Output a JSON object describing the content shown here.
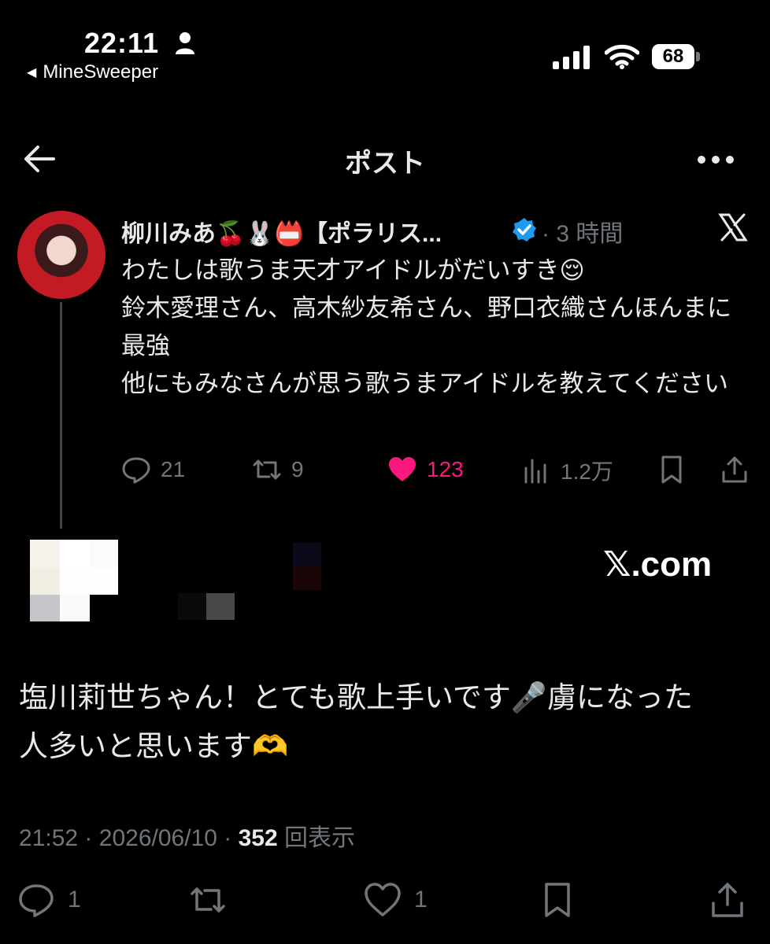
{
  "status_bar": {
    "time": "22:11",
    "back_app": "MineSweeper",
    "battery": "68"
  },
  "header": {
    "title": "ポスト"
  },
  "quoted_post": {
    "author_name": "柳川みあ🍒🐰📛【ポラリス...",
    "dot_time": "· 3 時間",
    "text": "わたしは歌うま天才アイドルがだいすき😌\n鈴木愛理さん、高木紗友希さん、野口衣織さんほんまに最強\n他にもみなさんが思う歌うまアイドルを教えてください",
    "replies": "21",
    "reposts": "9",
    "likes": "123",
    "views": "1.2万"
  },
  "embed": {
    "site": "𝕏.com"
  },
  "reply": {
    "text": "塩川莉世ちゃん！とても歌上手いです🎤虜になった\n人多いと思います🫶",
    "time": "21:52",
    "date": "2026/06/10",
    "view_count": "352",
    "view_label": "回表示",
    "sep": "·",
    "replies": "1",
    "likes": "1"
  },
  "colors": {
    "background": "#000000",
    "text": "#e7e9ea",
    "muted": "#71767b",
    "like": "#f91880",
    "verified": "#1d9bf0"
  }
}
